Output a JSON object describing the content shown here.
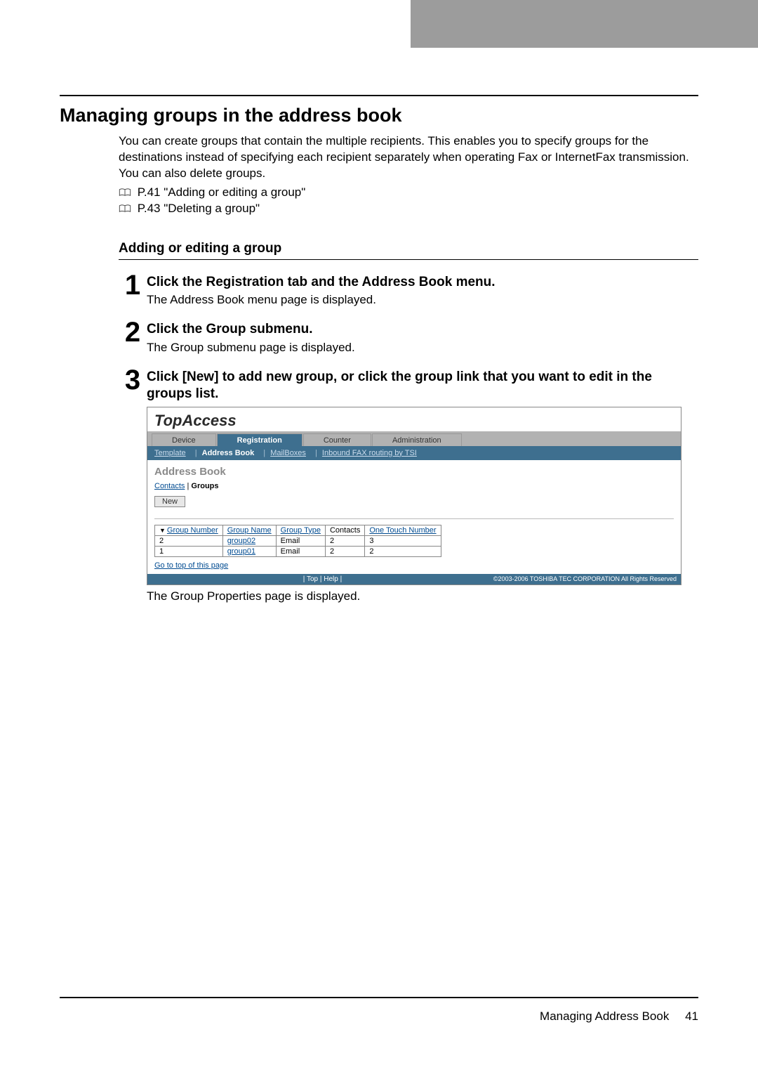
{
  "header": {
    "section_title": "Managing groups in the address book"
  },
  "intro": {
    "para": "You can create groups that contain the multiple recipients. This enables you to specify groups for the destinations instead of specifying each recipient separately when operating Fax or InternetFax transmission. You can also delete groups.",
    "ref1": "P.41 \"Adding or editing a group\"",
    "ref2": "P.43 \"Deleting a group\""
  },
  "subhead": "Adding or editing a group",
  "steps": [
    {
      "num": "1",
      "title": "Click the Registration tab and the Address Book menu.",
      "text": "The Address Book menu page is displayed."
    },
    {
      "num": "2",
      "title": "Click the Group submenu.",
      "text": "The Group submenu page is displayed."
    },
    {
      "num": "3",
      "title": "Click [New] to add new group, or click the group link that you want to edit in the groups list.",
      "text": ""
    }
  ],
  "screenshot": {
    "logo": "TopAccess",
    "tabs": [
      "Device",
      "Registration",
      "Counter",
      "Administration"
    ],
    "active_tab": "Registration",
    "subnav": [
      "Template",
      "Address Book",
      "MailBoxes",
      "Inbound FAX routing by TSI"
    ],
    "active_subnav": "Address Book",
    "heading": "Address Book",
    "bread_link": "Contacts",
    "bread_sep": " | ",
    "bread_current": "Groups",
    "new_btn": "New",
    "cols": [
      "Group Number",
      "Group Name",
      "Group Type",
      "Contacts",
      "One Touch Number"
    ],
    "rows": [
      {
        "num": "2",
        "name": "group02",
        "type": "Email",
        "contacts": "2",
        "onetouch": "3"
      },
      {
        "num": "1",
        "name": "group01",
        "type": "Email",
        "contacts": "2",
        "onetouch": "2"
      }
    ],
    "gotop": "Go to top of this page",
    "footer_links": "| Top | Help |",
    "footer_copy": "©2003-2006 TOSHIBA TEC CORPORATION All Rights Reserved"
  },
  "caption_after_shot": "The Group Properties page is displayed.",
  "footer": {
    "text": "Managing Address Book",
    "page": "41"
  }
}
